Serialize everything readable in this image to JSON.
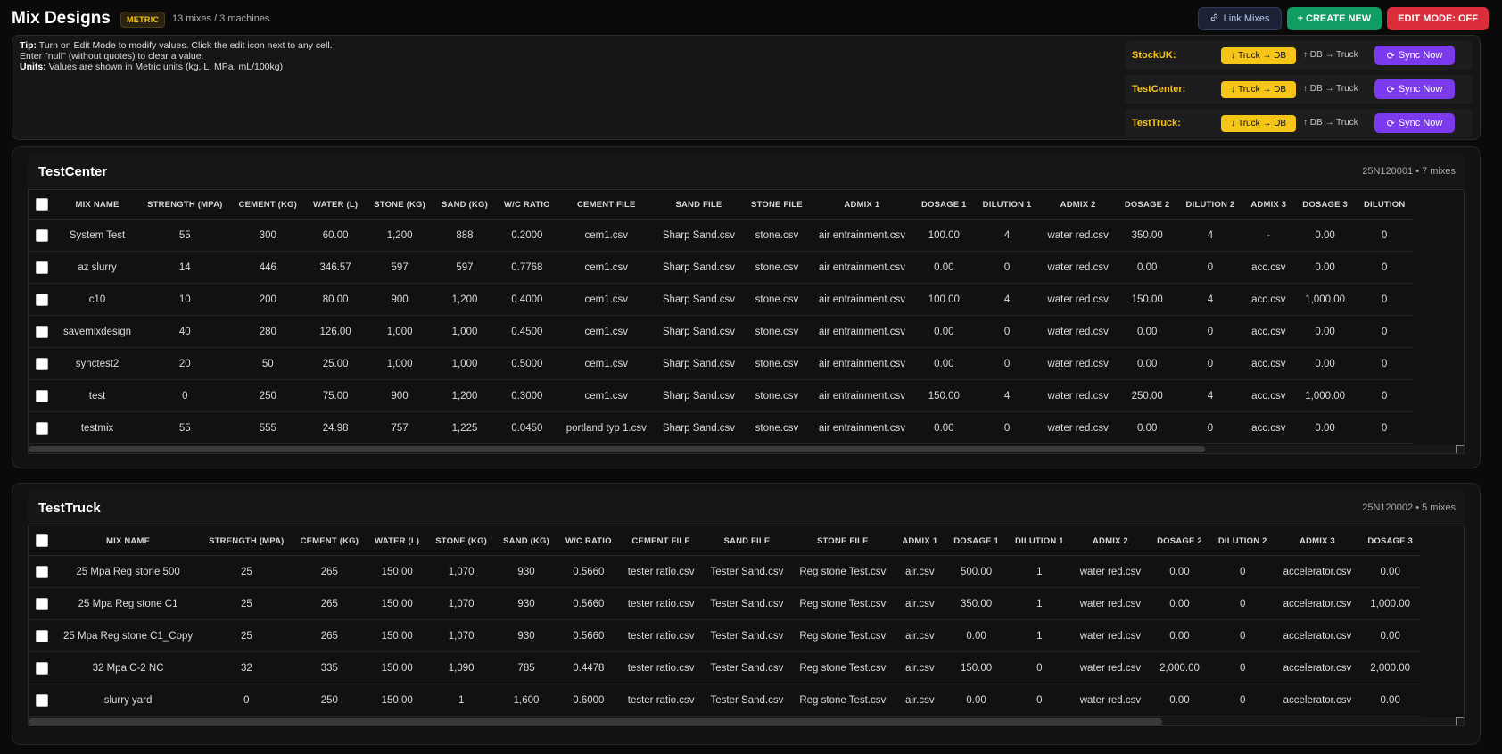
{
  "header": {
    "title": "Mix Designs",
    "unit_badge": "METRIC",
    "summary": "13 mixes / 3 machines",
    "link_label": "Link Mixes",
    "create_label": "+ CREATE NEW",
    "edit_label": "EDIT MODE: OFF"
  },
  "tips": {
    "tip_label": "Tip:",
    "tip_text": "Turn on Edit Mode to modify values. Click the edit icon next to any cell.",
    "null_text": "Enter \"null\" (without quotes) to clear a value.",
    "units_label": "Units:",
    "units_text": "Values are shown in Metric units (kg, L, MPa, mL/100kg)"
  },
  "sync": [
    {
      "name": "StockUK:",
      "truck_db": "Truck → DB",
      "db_truck": "DB → Truck",
      "sync": "Sync Now"
    },
    {
      "name": "TestCenter:",
      "truck_db": "Truck → DB",
      "db_truck": "DB → Truck",
      "sync": "Sync Now"
    },
    {
      "name": "TestTruck:",
      "truck_db": "Truck → DB",
      "db_truck": "DB → Truck",
      "sync": "Sync Now"
    }
  ],
  "machines": [
    {
      "name": "TestCenter",
      "info": "25N120001 • 7 mixes",
      "scroll_fraction": 0.82,
      "columns": [
        "MIX NAME",
        "STRENGTH (MPA)",
        "CEMENT (KG)",
        "WATER (L)",
        "STONE (KG)",
        "SAND (KG)",
        "W/C RATIO",
        "CEMENT FILE",
        "SAND FILE",
        "STONE FILE",
        "ADMIX 1",
        "DOSAGE 1",
        "DILUTION 1",
        "ADMIX 2",
        "DOSAGE 2",
        "DILUTION 2",
        "ADMIX 3",
        "DOSAGE 3",
        "DILUTION"
      ],
      "rows": [
        [
          "System Test",
          "55",
          "300",
          "60.00",
          "1,200",
          "888",
          "0.2000",
          "cem1.csv",
          "Sharp Sand.csv",
          "stone.csv",
          "air entrainment.csv",
          "100.00",
          "4",
          "water red.csv",
          "350.00",
          "4",
          "-",
          "0.00",
          "0"
        ],
        [
          "az slurry",
          "14",
          "446",
          "346.57",
          "597",
          "597",
          "0.7768",
          "cem1.csv",
          "Sharp Sand.csv",
          "stone.csv",
          "air entrainment.csv",
          "0.00",
          "0",
          "water red.csv",
          "0.00",
          "0",
          "acc.csv",
          "0.00",
          "0"
        ],
        [
          "c10",
          "10",
          "200",
          "80.00",
          "900",
          "1,200",
          "0.4000",
          "cem1.csv",
          "Sharp Sand.csv",
          "stone.csv",
          "air entrainment.csv",
          "100.00",
          "4",
          "water red.csv",
          "150.00",
          "4",
          "acc.csv",
          "1,000.00",
          "0"
        ],
        [
          "savemixdesign",
          "40",
          "280",
          "126.00",
          "1,000",
          "1,000",
          "0.4500",
          "cem1.csv",
          "Sharp Sand.csv",
          "stone.csv",
          "air entrainment.csv",
          "0.00",
          "0",
          "water red.csv",
          "0.00",
          "0",
          "acc.csv",
          "0.00",
          "0"
        ],
        [
          "synctest2",
          "20",
          "50",
          "25.00",
          "1,000",
          "1,000",
          "0.5000",
          "cem1.csv",
          "Sharp Sand.csv",
          "stone.csv",
          "air entrainment.csv",
          "0.00",
          "0",
          "water red.csv",
          "0.00",
          "0",
          "acc.csv",
          "0.00",
          "0"
        ],
        [
          "test",
          "0",
          "250",
          "75.00",
          "900",
          "1,200",
          "0.3000",
          "cem1.csv",
          "Sharp Sand.csv",
          "stone.csv",
          "air entrainment.csv",
          "150.00",
          "4",
          "water red.csv",
          "250.00",
          "4",
          "acc.csv",
          "1,000.00",
          "0"
        ],
        [
          "testmix",
          "55",
          "555",
          "24.98",
          "757",
          "1,225",
          "0.0450",
          "portland typ 1.csv",
          "Sharp Sand.csv",
          "stone.csv",
          "air entrainment.csv",
          "0.00",
          "0",
          "water red.csv",
          "0.00",
          "0",
          "acc.csv",
          "0.00",
          "0"
        ]
      ]
    },
    {
      "name": "TestTruck",
      "info": "25N120002 • 5 mixes",
      "scroll_fraction": 0.79,
      "columns": [
        "MIX NAME",
        "STRENGTH (MPA)",
        "CEMENT (KG)",
        "WATER (L)",
        "STONE (KG)",
        "SAND (KG)",
        "W/C RATIO",
        "CEMENT FILE",
        "SAND FILE",
        "STONE FILE",
        "ADMIX 1",
        "DOSAGE 1",
        "DILUTION 1",
        "ADMIX 2",
        "DOSAGE 2",
        "DILUTION 2",
        "ADMIX 3",
        "DOSAGE 3"
      ],
      "rows": [
        [
          "25 Mpa Reg stone 500",
          "25",
          "265",
          "150.00",
          "1,070",
          "930",
          "0.5660",
          "tester ratio.csv",
          "Tester Sand.csv",
          "Reg stone Test.csv",
          "air.csv",
          "500.00",
          "1",
          "water red.csv",
          "0.00",
          "0",
          "accelerator.csv",
          "0.00"
        ],
        [
          "25 Mpa Reg stone C1",
          "25",
          "265",
          "150.00",
          "1,070",
          "930",
          "0.5660",
          "tester ratio.csv",
          "Tester Sand.csv",
          "Reg stone Test.csv",
          "air.csv",
          "350.00",
          "1",
          "water red.csv",
          "0.00",
          "0",
          "accelerator.csv",
          "1,000.00"
        ],
        [
          "25 Mpa Reg stone C1_Copy",
          "25",
          "265",
          "150.00",
          "1,070",
          "930",
          "0.5660",
          "tester ratio.csv",
          "Tester Sand.csv",
          "Reg stone Test.csv",
          "air.csv",
          "0.00",
          "1",
          "water red.csv",
          "0.00",
          "0",
          "accelerator.csv",
          "0.00"
        ],
        [
          "32 Mpa C-2 NC",
          "32",
          "335",
          "150.00",
          "1,090",
          "785",
          "0.4478",
          "tester ratio.csv",
          "Tester Sand.csv",
          "Reg stone Test.csv",
          "air.csv",
          "150.00",
          "0",
          "water red.csv",
          "2,000.00",
          "0",
          "accelerator.csv",
          "2,000.00"
        ],
        [
          "slurry yard",
          "0",
          "250",
          "150.00",
          "1",
          "1,600",
          "0.6000",
          "tester ratio.csv",
          "Tester Sand.csv",
          "Reg stone Test.csv",
          "air.csv",
          "0.00",
          "0",
          "water red.csv",
          "0.00",
          "0",
          "accelerator.csv",
          "0.00"
        ]
      ]
    }
  ]
}
